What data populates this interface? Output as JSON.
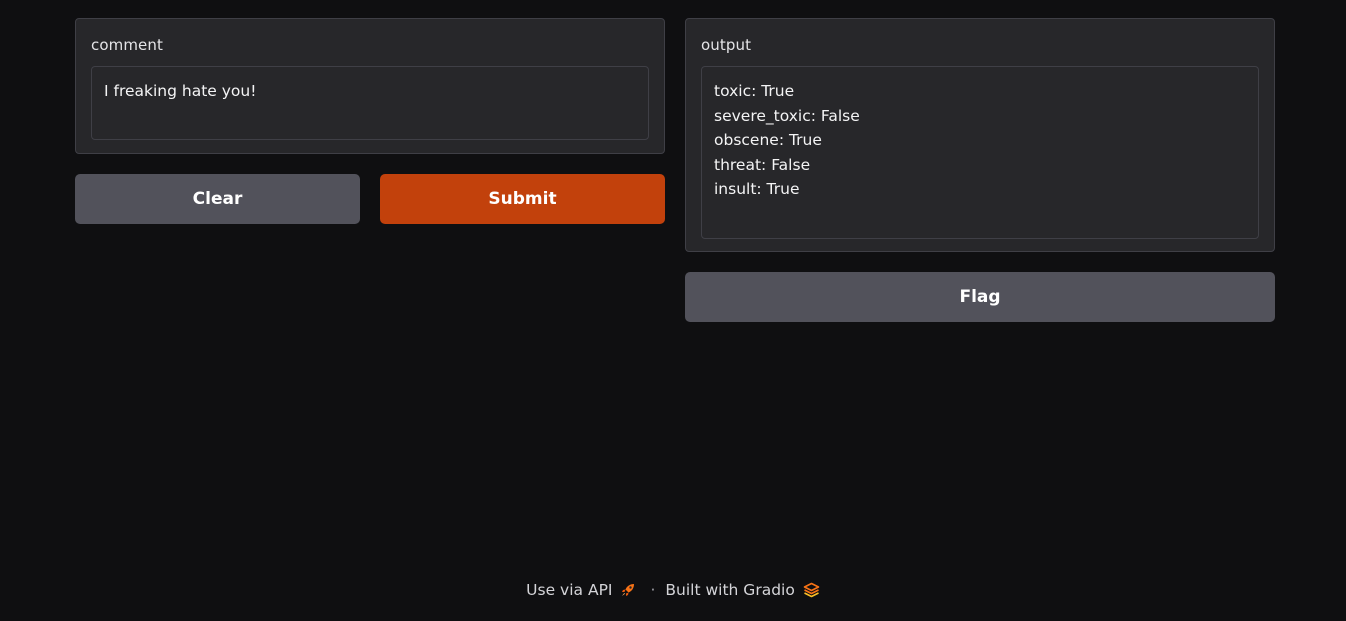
{
  "input_panel": {
    "label": "comment",
    "value": "I freaking hate you!"
  },
  "buttons": {
    "clear_label": "Clear",
    "submit_label": "Submit",
    "flag_label": "Flag"
  },
  "output_panel": {
    "label": "output",
    "value": "toxic: True\nsevere_toxic: False\nobscene: True\nthreat: False\ninsult: True"
  },
  "footer": {
    "api_label": "Use via API",
    "separator": "·",
    "built_label": "Built with Gradio"
  },
  "colors": {
    "background": "#0f0f11",
    "primary_button": "#c2410c",
    "secondary_button": "#52525b",
    "accent_icon": "#f97316"
  },
  "icons": {
    "api": "rocket-icon",
    "gradio": "gradio-logo-icon"
  }
}
